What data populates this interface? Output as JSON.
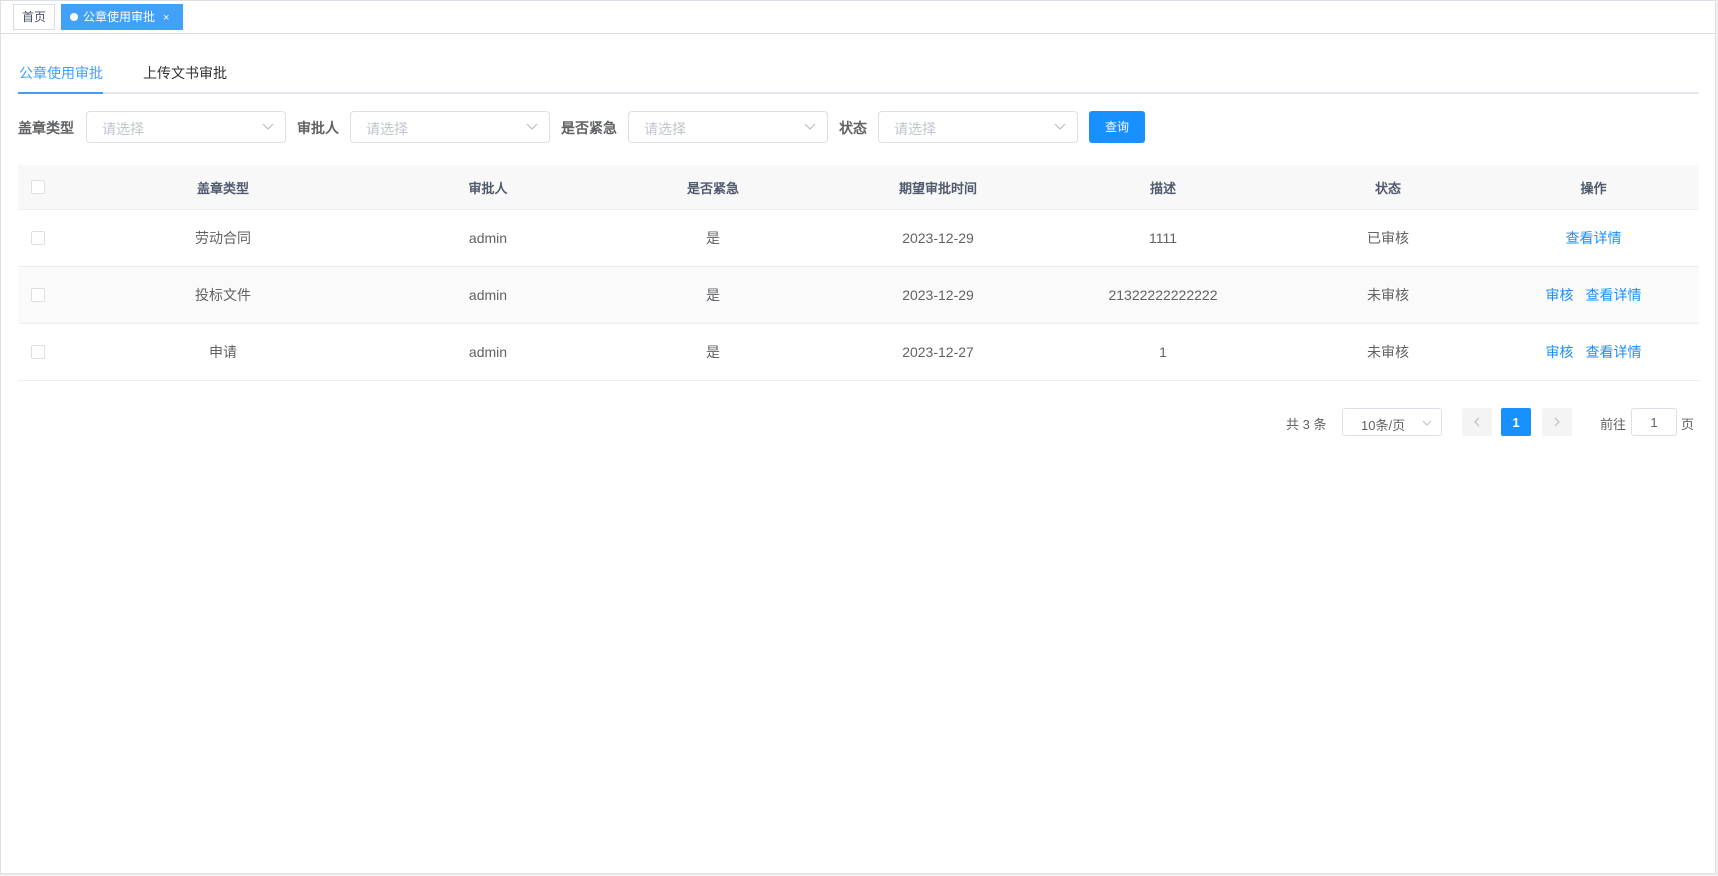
{
  "tags": {
    "home": "首页",
    "active": "公章使用审批",
    "close": "×"
  },
  "tabs": [
    {
      "label": "公章使用审批"
    },
    {
      "label": "上传文书审批"
    }
  ],
  "filter": {
    "fields": [
      {
        "label": "盖章类型",
        "placeholder": "请选择"
      },
      {
        "label": "审批人",
        "placeholder": "请选择"
      },
      {
        "label": "是否紧急",
        "placeholder": "请选择"
      },
      {
        "label": "状态",
        "placeholder": "请选择"
      }
    ],
    "query_label": "查询"
  },
  "table": {
    "headers": [
      "盖章类型",
      "审批人",
      "是否紧急",
      "期望审批时间",
      "描述",
      "状态",
      "操作"
    ],
    "rows": [
      {
        "type": "劳动合同",
        "approver": "admin",
        "urgent": "是",
        "date": "2023-12-29",
        "desc": "1111",
        "status": "已审核",
        "actions": [
          "查看详情"
        ]
      },
      {
        "type": "投标文件",
        "approver": "admin",
        "urgent": "是",
        "date": "2023-12-29",
        "desc": "21322222222222",
        "status": "未审核",
        "actions": [
          "审核",
          "查看详情"
        ]
      },
      {
        "type": "申请",
        "approver": "admin",
        "urgent": "是",
        "date": "2023-12-27",
        "desc": "1",
        "status": "未审核",
        "actions": [
          "审核",
          "查看详情"
        ]
      }
    ]
  },
  "pagination": {
    "total": "共 3 条",
    "page_size": "10条/页",
    "current_page": "1",
    "goto_label": "前往",
    "page_unit": "页",
    "goto_value": "1"
  },
  "colors": {
    "accent": "#1890ff",
    "tag_active": "#42a0f8"
  }
}
